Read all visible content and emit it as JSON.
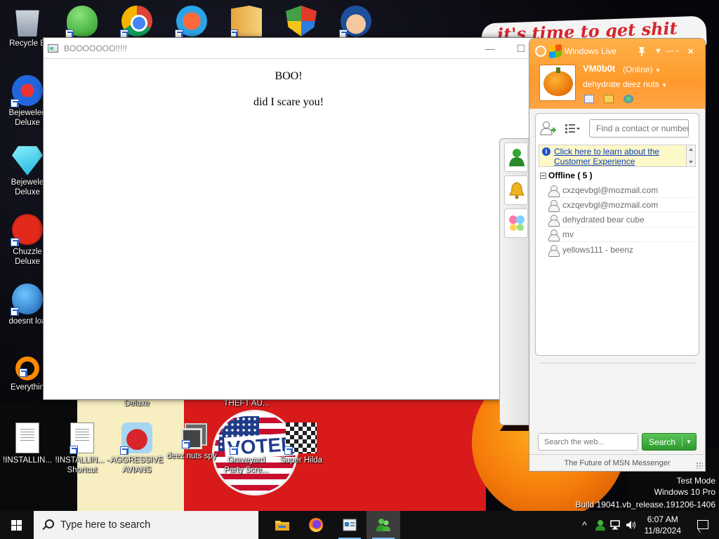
{
  "wallpaper": {
    "banner_text": "it's time to get shit"
  },
  "desktop_icons": [
    {
      "label": "Recycle B",
      "icon": "recycle-bin-icon"
    },
    {
      "label": "",
      "icon": "msn-messenger-icon"
    },
    {
      "label": "",
      "icon": "chrome-icon"
    },
    {
      "label": "",
      "icon": "peggle-icon"
    },
    {
      "label": "",
      "icon": "folder-icon"
    },
    {
      "label": "",
      "icon": "windows-shield-icon"
    },
    {
      "label": "",
      "icon": "character-face-icon"
    },
    {
      "label": "Bejeweled Deluxe",
      "icon": "bejeweled2-icon"
    },
    {
      "label": "Bejewele Deluxe",
      "icon": "bejeweled-diamond-icon"
    },
    {
      "label": "Chuzzle Deluxe",
      "icon": "chuzzle-icon"
    },
    {
      "label": "doesnt loa",
      "icon": "blue-bird-icon"
    },
    {
      "label": "Everythin",
      "icon": "everything-search-icon"
    },
    {
      "label": "!INSTALLIN...",
      "icon": "document-icon"
    },
    {
      "label": "!INSTALLIN... - Shortcut",
      "icon": "document-shortcut-icon"
    },
    {
      "label": "AGGRESSIVE AVIANS",
      "icon": "angry-bird-icon"
    },
    {
      "label": "deez nuts spy",
      "icon": "window-stack-icon"
    },
    {
      "label": "Graveyard Party Scre...",
      "icon": "voted-badge-icon"
    },
    {
      "label": "Super Hilda",
      "icon": "pixel-game-icon"
    },
    {
      "label": "Deluxe",
      "icon": ""
    },
    {
      "label": "THEFT AU...",
      "icon": ""
    }
  ],
  "voted_badge_text": "VOTED",
  "boo_window": {
    "title": "BOOOOOOO!!!!!",
    "heading": "BOO!",
    "message": "did I scare you!",
    "controls": {
      "minimize": "—",
      "maximize": "☐"
    }
  },
  "messenger": {
    "brand": "Windows Live",
    "controls": {
      "menu": "▼",
      "minimize": "—",
      "maximize": "▫",
      "close": "✕"
    },
    "user": {
      "name": "VM0b0t",
      "status": "(Online)",
      "personal_message": "dehydrate deez nuts"
    },
    "contact_search_placeholder": "Find a contact or number",
    "info_link": "Click here to learn about the Customer Experience",
    "groups": [
      {
        "name": "Offline ( 5 )",
        "contacts": [
          "cxzqevbgl@mozmail.com",
          "cxzqevbgl@mozmail.com",
          "dehydrated bear cube",
          "mv",
          "yellows111 - beenz"
        ]
      }
    ],
    "web_search_placeholder": "Search the web...",
    "search_button": "Search",
    "footer": "The Future of MSN Messenger"
  },
  "watermark": {
    "line1": "Test Mode",
    "line2": "Windows 10 Pro",
    "line3": "Build 19041.vb_release.191206-1406"
  },
  "taskbar": {
    "search_placeholder": "Type here to search",
    "apps": [
      "file-explorer-icon",
      "firefox-icon",
      "boo-app-icon",
      "msn-messenger-icon"
    ],
    "tray_chevron": "^",
    "time": "6:07 AM",
    "date": "11/8/2024"
  },
  "colors": {
    "msn_header": "#ff9a2c",
    "search_green": "#2c9a2c",
    "link_blue": "#0a3dbc",
    "taskbar": "#101010"
  }
}
